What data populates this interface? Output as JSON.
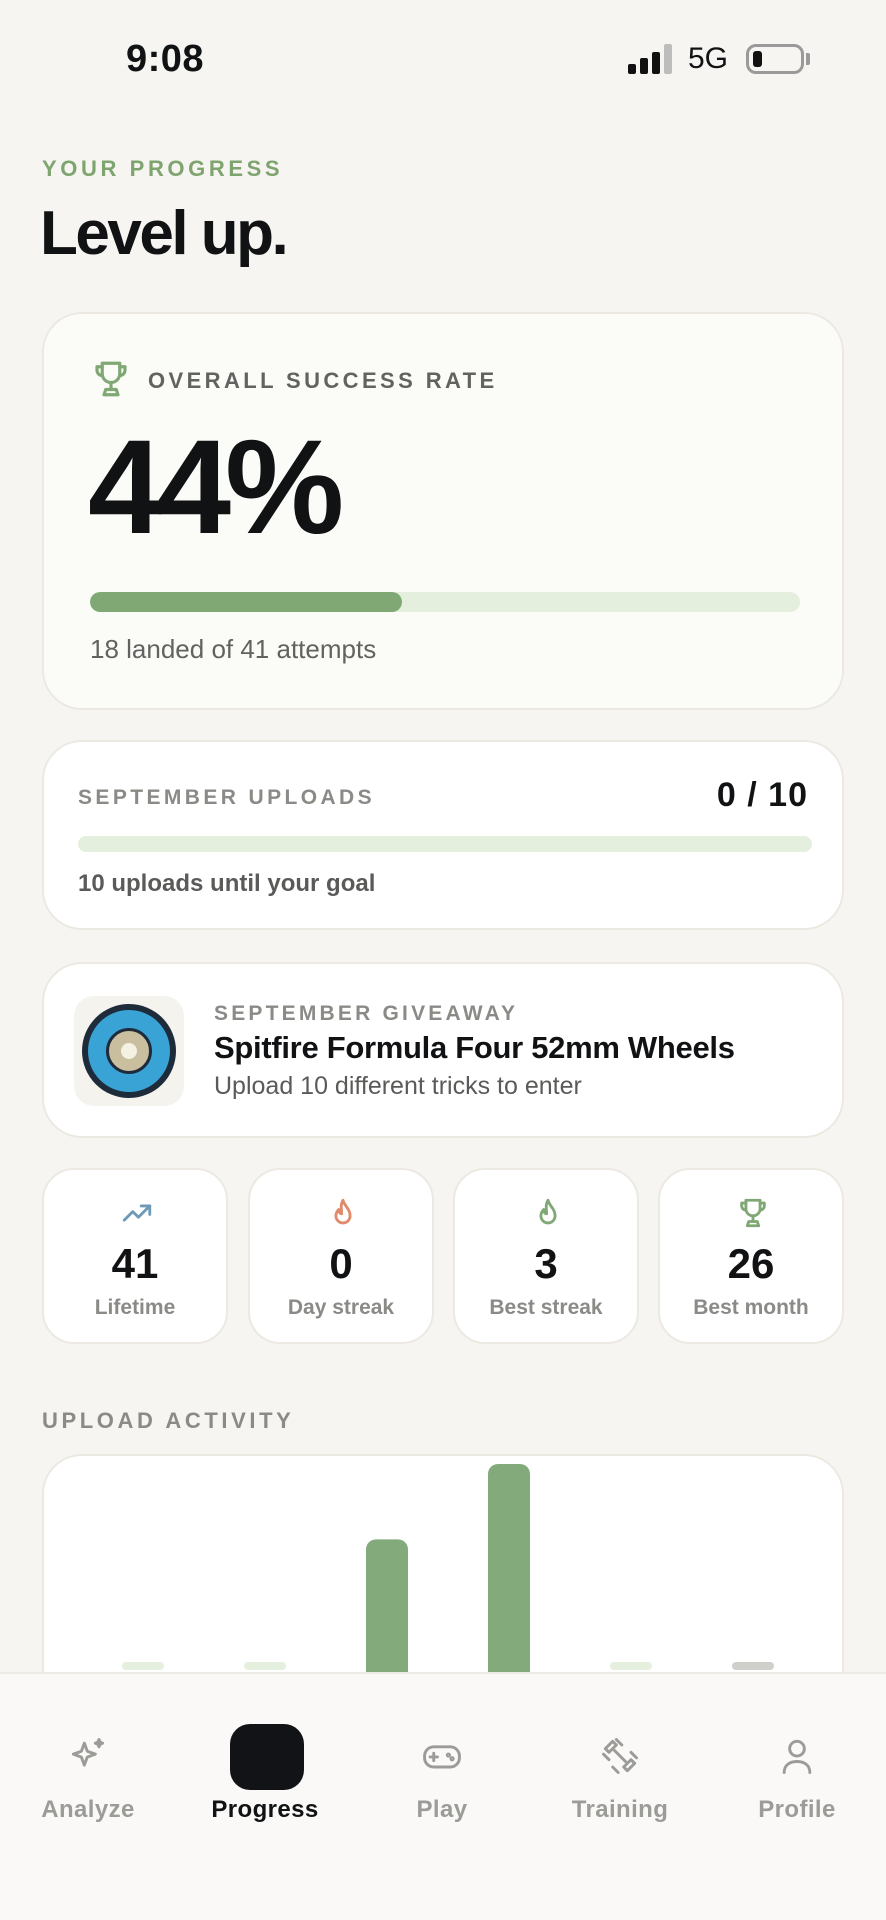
{
  "status_bar": {
    "time": "9:08",
    "network": "5G"
  },
  "header": {
    "eyebrow": "YOUR PROGRESS",
    "title": "Level up."
  },
  "success": {
    "label": "OVERALL SUCCESS RATE",
    "value": "44%",
    "progress": 0.44,
    "caption": "18 landed of 41 attempts",
    "icon": "trophy-icon"
  },
  "uploads": {
    "label": "SEPTEMBER UPLOADS",
    "count": "0 / 10",
    "progress": 0,
    "caption": "10 uploads until your goal"
  },
  "giveaway": {
    "label": "SEPTEMBER GIVEAWAY",
    "title": "Spitfire Formula Four 52mm Wheels",
    "subtitle": "Upload 10 different tricks to enter",
    "image": "spitfire-wheel-image"
  },
  "stats": [
    {
      "value": "41",
      "label": "Lifetime",
      "icon": "trending-up-icon",
      "color": "#6e9ab8"
    },
    {
      "value": "0",
      "label": "Day streak",
      "icon": "flame-icon",
      "color": "#e08a6a"
    },
    {
      "value": "3",
      "label": "Best streak",
      "icon": "flame-icon",
      "color": "#7fa874"
    },
    {
      "value": "26",
      "label": "Best month",
      "icon": "trophy-icon",
      "color": "#7fa874"
    }
  ],
  "activity": {
    "label": "UPLOAD ACTIVITY"
  },
  "chart_data": {
    "type": "bar",
    "title": "",
    "categories": [
      "",
      "",
      "",
      "",
      "",
      ""
    ],
    "values": [
      0,
      0,
      26,
      41,
      0,
      0
    ],
    "ylim": [
      0,
      41
    ],
    "bar_color": "#82aa7a",
    "empty_color": "#e5efdd",
    "current_color": "#cfcfcc",
    "grid": false
  },
  "tabs": [
    {
      "label": "Analyze",
      "icon": "sparkle-icon",
      "active": false
    },
    {
      "label": "Progress",
      "icon": "progress-icon",
      "active": true
    },
    {
      "label": "Play",
      "icon": "gamepad-icon",
      "active": false
    },
    {
      "label": "Training",
      "icon": "dumbbell-icon",
      "active": false
    },
    {
      "label": "Profile",
      "icon": "person-icon",
      "active": false
    }
  ],
  "colors": {
    "accent": "#7fa874",
    "background": "#f6f5f1",
    "text": "#111214"
  }
}
